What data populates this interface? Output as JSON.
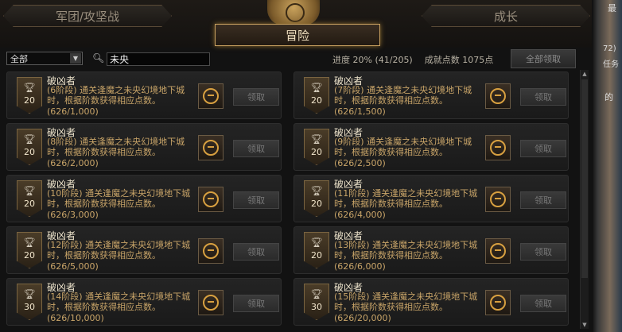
{
  "tabs": {
    "left_label": "军团/攻坚战",
    "right_label": "成长",
    "active_label": "冒险"
  },
  "filter": {
    "category_value": "全部",
    "search_value": "未央"
  },
  "summary": {
    "progress_label": "进度",
    "progress_value": "20% (41/205)",
    "points_label": "成就点数",
    "points_value": "1075点",
    "claim_all_label": "全部领取"
  },
  "achievements": [
    {
      "title": "破凶者",
      "desc": "(6阶段) 通关逢魔之未央幻境地下城时，根据阶数获得相应点数。",
      "progress": "(626/1,000)",
      "points": "20",
      "claim": "领取"
    },
    {
      "title": "破凶者",
      "desc": "(7阶段) 通关逢魔之未央幻境地下城时，根据阶数获得相应点数。",
      "progress": "(626/1,500)",
      "points": "20",
      "claim": "领取"
    },
    {
      "title": "破凶者",
      "desc": "(8阶段) 通关逢魔之未央幻境地下城时，根据阶数获得相应点数。",
      "progress": "(626/2,000)",
      "points": "20",
      "claim": "领取"
    },
    {
      "title": "破凶者",
      "desc": "(9阶段) 通关逢魔之未央幻境地下城时，根据阶数获得相应点数。",
      "progress": "(626/2,500)",
      "points": "20",
      "claim": "领取"
    },
    {
      "title": "破凶者",
      "desc": "(10阶段) 通关逢魔之未央幻境地下城时，根据阶数获得相应点数。",
      "progress": "(626/3,000)",
      "points": "20",
      "claim": "领取"
    },
    {
      "title": "破凶者",
      "desc": "(11阶段) 通关逢魔之未央幻境地下城时，根据阶数获得相应点数。",
      "progress": "(626/4,000)",
      "points": "20",
      "claim": "领取"
    },
    {
      "title": "破凶者",
      "desc": "(12阶段) 通关逢魔之未央幻境地下城时，根据阶数获得相应点数。",
      "progress": "(626/5,000)",
      "points": "20",
      "claim": "领取"
    },
    {
      "title": "破凶者",
      "desc": "(13阶段) 通关逢魔之未央幻境地下城时，根据阶数获得相应点数。",
      "progress": "(626/6,000)",
      "points": "20",
      "claim": "领取"
    },
    {
      "title": "破凶者",
      "desc": "(14阶段) 通关逢魔之未央幻境地下城时，根据阶数获得相应点数。",
      "progress": "(626/10,000)",
      "points": "30",
      "claim": "领取"
    },
    {
      "title": "破凶者",
      "desc": "(15阶段) 通关逢魔之未央幻境地下城时，根据阶数获得相应点数。",
      "progress": "(626/20,000)",
      "points": "30",
      "claim": "领取"
    }
  ],
  "background": {
    "t1": "最",
    "t2": "72)",
    "t3": "任务",
    "t4": "的"
  },
  "colors": {
    "accent_gold": "#c8a060",
    "desc_text": "#c8a468"
  }
}
